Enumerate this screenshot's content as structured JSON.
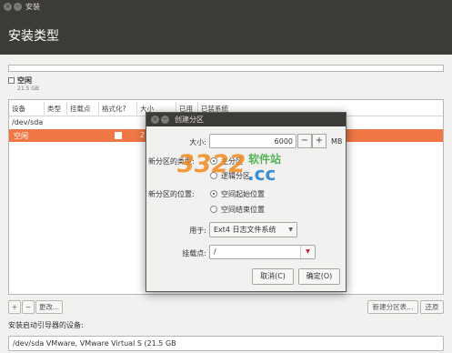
{
  "window": {
    "title": "安装"
  },
  "header": {
    "title": "安装类型"
  },
  "disk_legend": {
    "name": "空闲",
    "size": "21.5 GB"
  },
  "table": {
    "columns": [
      "设备",
      "类型",
      "挂载点",
      "格式化?",
      "大小",
      "已用",
      "已装系统"
    ],
    "device": "/dev/sda",
    "selected_row": {
      "name": "空闲",
      "size": "21"
    }
  },
  "toolbar": {
    "add": "+",
    "remove": "−",
    "change": "更改...",
    "new_table": "新建分区表...",
    "revert": "还原"
  },
  "boot": {
    "label": "安装启动引导器的设备:",
    "value": "/dev/sda   VMware, VMware Virtual S (21.5 GB"
  },
  "dialog": {
    "title": "创建分区",
    "size_label": "大小:",
    "size_value": "6000",
    "minus": "−",
    "plus": "+",
    "unit": "MB",
    "type_label": "新分区的类型:",
    "type_options": [
      "主分区",
      "逻辑分区"
    ],
    "location_label": "新分区的位置:",
    "location_options": [
      "空间起始位置",
      "空间结束位置"
    ],
    "use_label": "用于:",
    "use_value": "Ext4 日志文件系统",
    "mount_label": "挂载点:",
    "mount_value": "/",
    "cancel": "取消(C)",
    "ok": "确定(O)"
  },
  "watermark": {
    "number": "3322",
    "site": "软件站",
    "domain": ".cc"
  },
  "colors": {
    "accent": "#f07746",
    "header": "#3c3b37",
    "watermark_orange": "#f08a1e",
    "watermark_green": "#3aa63c",
    "watermark_blue": "#1e7ec8"
  }
}
